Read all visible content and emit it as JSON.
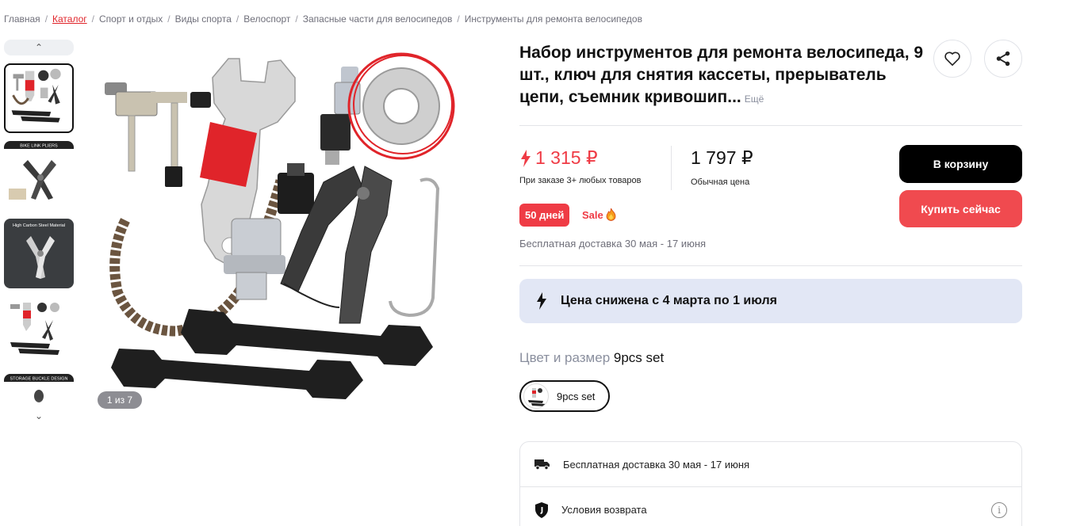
{
  "breadcrumb": [
    {
      "label": "Главная",
      "active": false
    },
    {
      "label": "Каталог",
      "active": true
    },
    {
      "label": "Спорт и отдых",
      "active": false
    },
    {
      "label": "Виды спорта",
      "active": false
    },
    {
      "label": "Велоспорт",
      "active": false
    },
    {
      "label": "Запасные части для велосипедов",
      "active": false
    },
    {
      "label": "Инструменты для ремонта велосипедов",
      "active": false
    }
  ],
  "gallery": {
    "counter": "1 из 7",
    "thumb_captions": [
      "BIKE LINK PLIERS",
      "High Carbon Steel Material",
      "STORAGE BUCKLE DESIGN"
    ]
  },
  "product": {
    "title": "Набор инструментов для ремонта велосипеда, 9 шт., ключ для снятия кассеты, прерыватель цепи, съемник кривошип...",
    "more_label": "Ещё"
  },
  "pricing": {
    "current_price": "1 315 ₽",
    "current_note": "При заказе 3+ любых товаров",
    "regular_price": "1 797 ₽",
    "regular_note": "Обычная цена",
    "days_badge": "50 дней",
    "sale_label": "Sale",
    "delivery": "Бесплатная доставка 30 мая - 17 июня"
  },
  "actions": {
    "cart_label": "В корзину",
    "buy_now_label": "Купить сейчас"
  },
  "promo": {
    "text": "Цена снижена с 4 марта по 1 июля"
  },
  "variant": {
    "label": "Цвет и размер",
    "value": "9pcs set",
    "options": [
      "9pcs set"
    ]
  },
  "info": {
    "delivery": "Бесплатная доставка 30 мая - 17 июня",
    "returns": "Условия возврата"
  },
  "colors": {
    "accent_red": "#ef3b45",
    "buy_button": "#f04a4f",
    "cart_button": "#000000",
    "promo_bg": "#e2e7f5"
  }
}
